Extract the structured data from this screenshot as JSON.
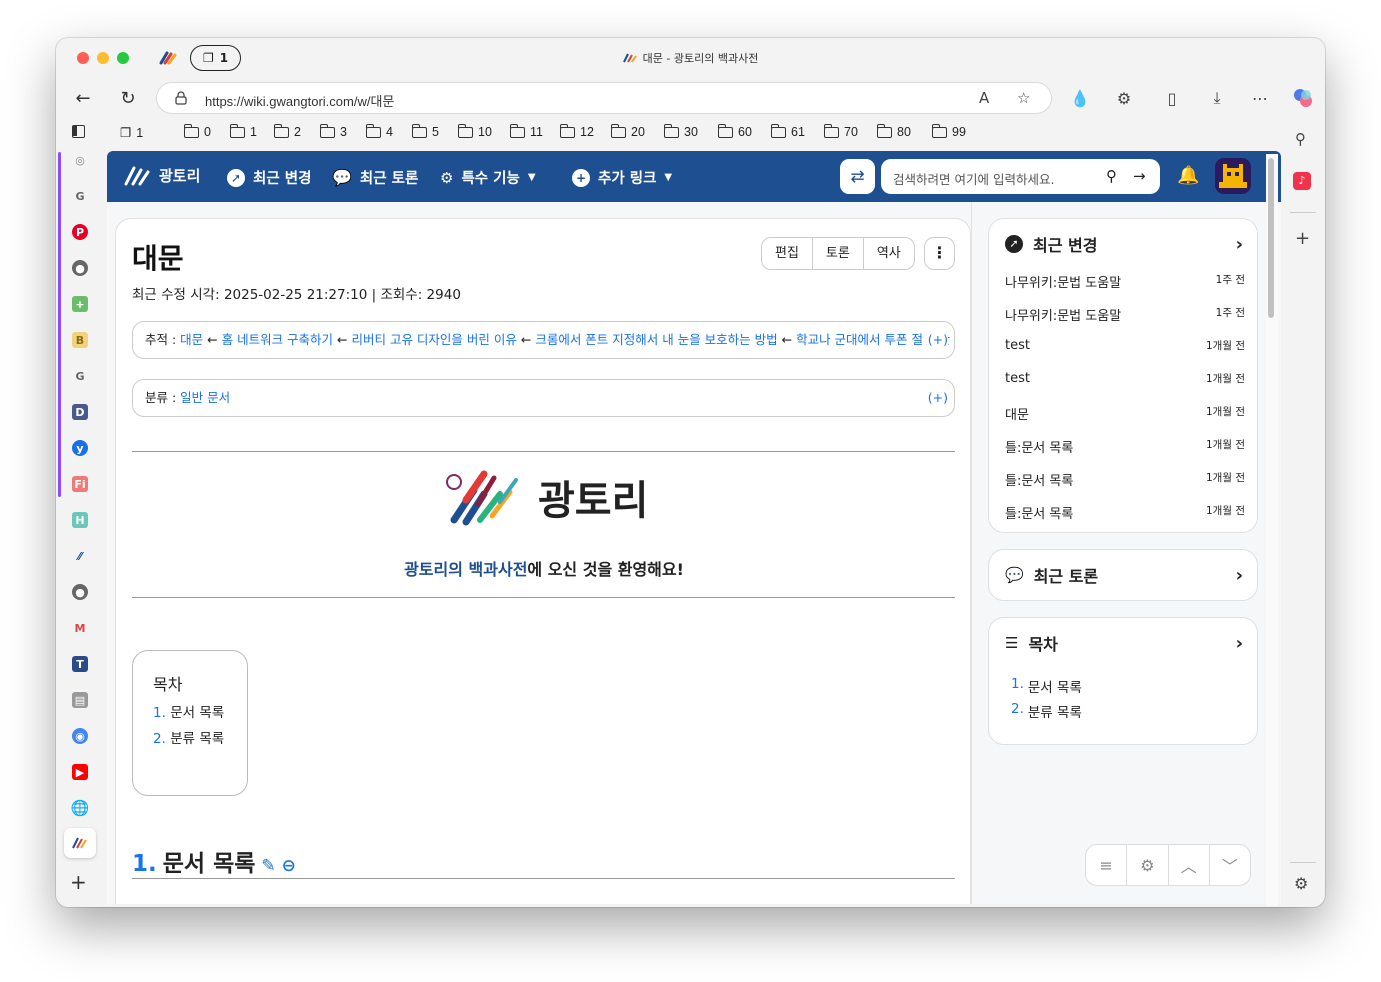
{
  "browser": {
    "window_title": "대문 - 광토리의 백과사전",
    "tab_count": "1",
    "url": "https://wiki.gwangtori.com/w/대문",
    "bookmarks": [
      {
        "label": "1",
        "kind": "tabs"
      },
      {
        "label": "0"
      },
      {
        "label": "1"
      },
      {
        "label": "2"
      },
      {
        "label": "3"
      },
      {
        "label": "4"
      },
      {
        "label": "5"
      },
      {
        "label": "10"
      },
      {
        "label": "11"
      },
      {
        "label": "12"
      },
      {
        "label": "20"
      },
      {
        "label": "30"
      },
      {
        "label": "60"
      },
      {
        "label": "61"
      },
      {
        "label": "70"
      },
      {
        "label": "80"
      },
      {
        "label": "99"
      }
    ]
  },
  "wiki_nav": {
    "brand": "광토리",
    "recent_changes": "최근 변경",
    "recent_discuss": "최근 토론",
    "special": "특수 기능",
    "extra_links": "추가 링크",
    "search_placeholder": "검색하려면 여기에 입력하세요."
  },
  "article": {
    "title": "대문",
    "meta": "최근 수정 시각: 2025-02-25 21:27:10 | 조회수: 2940",
    "buttons": {
      "edit": "편집",
      "discuss": "토론",
      "history": "역사"
    },
    "trail_label": "추적 : ",
    "trail": [
      "대문",
      "홈 네트워크 구축하기",
      "리버티 고유 디자인을 버린 이유",
      "크롬에서 폰트 지정해서 내 눈을 보호하는 방법",
      "학교나 군대에서 투폰 절대 안 ..."
    ],
    "trail_arrow": " ← ",
    "trail_plus": "(+)",
    "category_label": "분류 : ",
    "category": "일반 문서",
    "category_plus": "(+)",
    "logo_text": "광토리",
    "welcome_highlight": "광토리의 백과사전",
    "welcome_rest": "에 오신 것을 환영해요!",
    "toc": {
      "title": "목차",
      "items": [
        {
          "num": "1.",
          "label": "문서 목록"
        },
        {
          "num": "2.",
          "label": "분류 목록"
        }
      ]
    },
    "section1": {
      "num": "1.",
      "title": "문서 목록"
    }
  },
  "sidebar": {
    "recent_changes": {
      "title": "최근 변경",
      "items": [
        {
          "title": "나무위키:문법 도움말",
          "time": "1주 전"
        },
        {
          "title": "나무위키:문법 도움말",
          "time": "1주 전"
        },
        {
          "title": "test",
          "time": "1개월 전"
        },
        {
          "title": "test",
          "time": "1개월 전"
        },
        {
          "title": "대문",
          "time": "1개월 전"
        },
        {
          "title": "틀:문서 목록",
          "time": "1개월 전"
        },
        {
          "title": "틀:문서 목록",
          "time": "1개월 전"
        },
        {
          "title": "틀:문서 목록",
          "time": "1개월 전"
        }
      ]
    },
    "recent_discuss": {
      "title": "최근 토론"
    },
    "toc": {
      "title": "목차",
      "items": [
        {
          "num": "1.",
          "label": "문서 목록"
        },
        {
          "num": "2.",
          "label": "분류 목록"
        }
      ]
    }
  },
  "colors": {
    "brand": "#1e4f91",
    "link": "#1a73e8"
  }
}
